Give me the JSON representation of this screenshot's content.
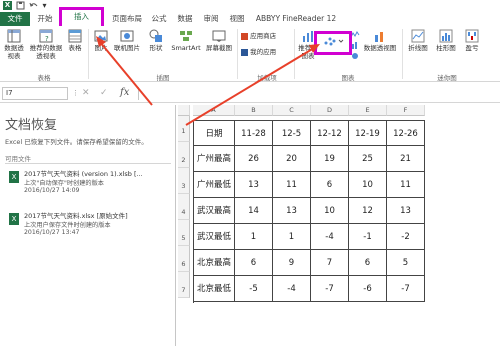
{
  "titlebar": {
    "logo": "X",
    "save_icon": "save-icon",
    "undo_icon": "undo-icon"
  },
  "tabs": [
    {
      "label": "文件"
    },
    {
      "label": "开始"
    },
    {
      "label": "插入"
    },
    {
      "label": "页面布局"
    },
    {
      "label": "公式"
    },
    {
      "label": "数据"
    },
    {
      "label": "审阅"
    },
    {
      "label": "视图"
    },
    {
      "label": "ABBYY FineReader 12"
    }
  ],
  "ribbon": {
    "buttons": {
      "pivot": "数据透视表",
      "rec_pivot": "推荐的数据透视表",
      "table": "表格",
      "pictures": "图片",
      "online_pictures": "联机图片",
      "shapes": "形状",
      "smartart": "SmartArt",
      "screenshot": "屏幕截图",
      "app_store": "应用商店",
      "my_apps": "我的应用",
      "rec_charts": "推荐的图表",
      "pivot_chart": "数据透视图",
      "spark_line": "折线图",
      "spark_column": "柱形图",
      "spark_winloss": "盈亏"
    },
    "groups": {
      "tables": "表格",
      "illustrations": "插图",
      "apps": "加载项",
      "charts": "图表",
      "sparklines": "迷你图"
    }
  },
  "formula_bar": {
    "name_box": "I7",
    "fx": "fx"
  },
  "recovery": {
    "title": "文档恢复",
    "desc": "Excel 已恢复下列文件。请保存希望保留的文件。",
    "available": "可用文件",
    "files": [
      {
        "name": "2017节气天气资料 (version 1).xlsb  [...",
        "sub": "上次\"自动保存\"时创建的版本",
        "date": "2016/10/27 14:09"
      },
      {
        "name": "2017节气天气资料.xlsx  [原始文件]",
        "sub": "上次用户保存文件时创建的版本",
        "date": "2016/10/27 13:47"
      }
    ]
  },
  "sheet": {
    "columns": [
      "A",
      "B",
      "C",
      "D",
      "E",
      "F"
    ],
    "rows": [
      "1",
      "2",
      "3",
      "4",
      "5",
      "6",
      "7"
    ],
    "table": [
      [
        "日期",
        "11-28",
        "12-5",
        "12-12",
        "12-19",
        "12-26"
      ],
      [
        "广州最高",
        "26",
        "20",
        "19",
        "25",
        "21"
      ],
      [
        "广州最低",
        "13",
        "11",
        "6",
        "10",
        "11"
      ],
      [
        "武汉最高",
        "14",
        "13",
        "10",
        "12",
        "13"
      ],
      [
        "武汉最低",
        "1",
        "1",
        "-4",
        "-1",
        "-2"
      ],
      [
        "北京最高",
        "6",
        "9",
        "7",
        "6",
        "5"
      ],
      [
        "北京最低",
        "-5",
        "-4",
        "-7",
        "-6",
        "-7"
      ]
    ]
  },
  "colors": {
    "excel_green": "#217346",
    "highlight": "#d100d1",
    "arrow": "#e8402a"
  }
}
